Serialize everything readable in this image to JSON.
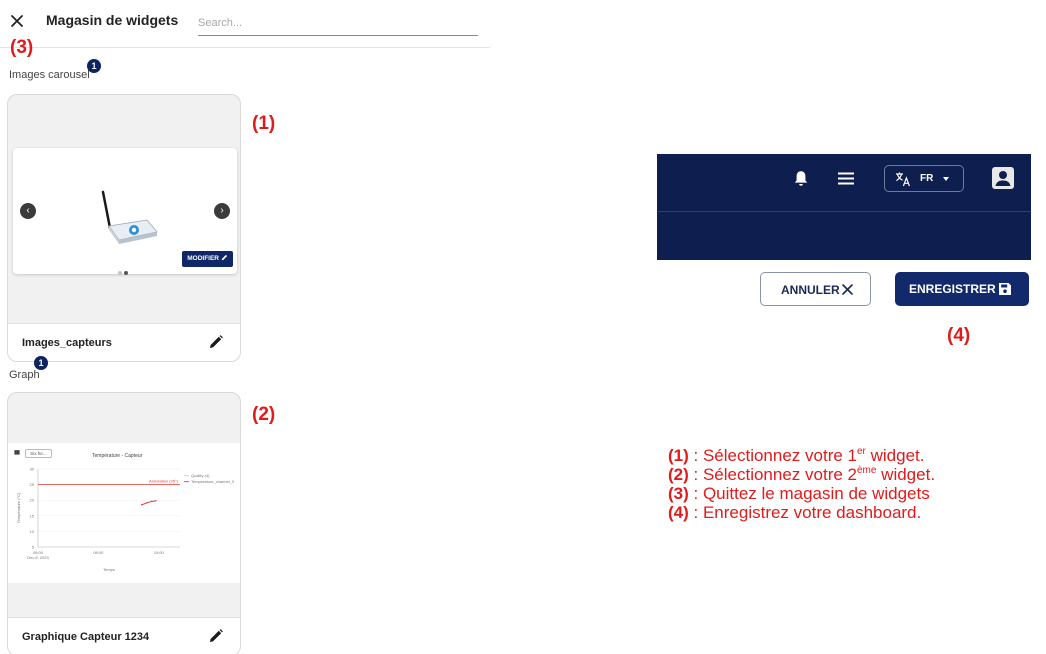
{
  "store": {
    "title": "Magasin de widgets",
    "search_placeholder": "Search...",
    "close_icon": "close-icon"
  },
  "sections": {
    "carousel": {
      "label": "Images carousel",
      "count": "1"
    },
    "graph": {
      "label": "Graph",
      "count": "1"
    }
  },
  "widgets": {
    "carousel": {
      "name": "Images_capteurs",
      "modifier_label": "MODIFIER"
    },
    "graph": {
      "name": "Graphique Capteur 1234",
      "date_selector": "Six he...",
      "chart_title": "Température - Capteur"
    }
  },
  "chart_data": {
    "type": "line",
    "title": "Température - Capteur",
    "xlabel": "Temps",
    "ylabel": "Température (°C)",
    "y_ticks": [
      "30",
      "25",
      "20",
      "15",
      "10",
      "5"
    ],
    "x_ticks": [
      "06:00",
      "08:00",
      "10:00"
    ],
    "x_date_label": "Dec 8, 2023",
    "legend": [
      "Quality (4)",
      "Temperature_channel_0"
    ],
    "threshold_label": "Annotation (25°)",
    "threshold_value": 25,
    "series": [
      {
        "name": "Temperature_channel_0",
        "x": [
          0.73,
          0.77,
          0.8,
          0.83
        ],
        "y": [
          18.5,
          19.2,
          19.6,
          19.8
        ]
      }
    ],
    "ylim": [
      5,
      30
    ]
  },
  "dashboard": {
    "language": "FR",
    "cancel_label": "ANNULER",
    "save_label": "ENREGISTRER",
    "bar_color": "#0e1f4f",
    "accent_color": "#122a6b"
  },
  "annotations": {
    "label_1": "(1)",
    "label_2": "(2)",
    "label_3": "(3)",
    "label_4": "(4)",
    "color": "#e01b1b"
  },
  "legend": {
    "l1_num": "(1)",
    "l1_a": " : Sélectionnez votre 1",
    "l1_sup": "er",
    "l1_b": " widget.",
    "l2_num": "(2)",
    "l2_a": " : Sélectionnez votre 2",
    "l2_sup": "ème",
    "l2_b": " widget.",
    "l3_num": "(3)",
    "l3_a": " : Quittez le magasin de widgets",
    "l4_num": "(4)",
    "l4_a": " : Enregistrez votre dashboard."
  }
}
